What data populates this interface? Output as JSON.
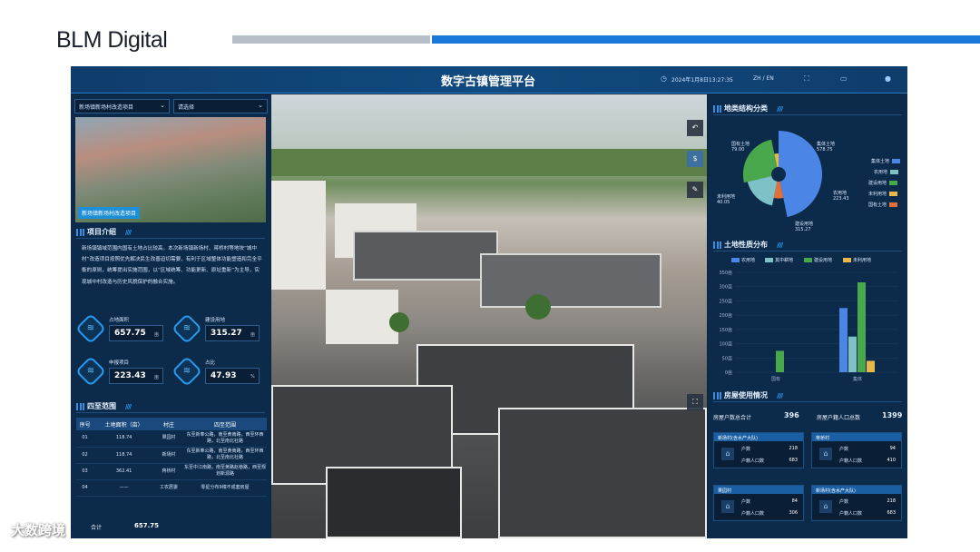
{
  "brand": {
    "name": "BLM Digital"
  },
  "header": {
    "title": "数字古镇管理平台",
    "datetime": "2024年1月8日13:27:35",
    "lang": "ZH / EN"
  },
  "left": {
    "project_select": "新场镇新场村改造项目",
    "filter_select": "请选择",
    "photo_caption": "新场镇新场村改造项目",
    "intro_title": "项目介绍",
    "intro_text": "新场镇镇域范围内国有土地占比较高。本次新场镇新场村、蒋桥村等地块“城中村”改造项目按照优先解决民生改善迫切需要，有利于区域整体功能塑造和完全平衡的原则，统筹提出实施范围，以“区域统筹、功能更新、原址重新”为主导，实现城中村改造与历史风貌保护的融合实施。",
    "stats": [
      {
        "label": "占地面积",
        "value": "657.75",
        "unit": "亩"
      },
      {
        "label": "建设用地",
        "value": "315.27",
        "unit": "亩"
      },
      {
        "label": "申报项目",
        "value": "223.43",
        "unit": "亩"
      },
      {
        "label": "占比",
        "value": "47.93",
        "unit": "%"
      }
    ],
    "boundary_title": "四至范围",
    "boundary_headers": [
      "序号",
      "土地面积（亩）",
      "村庄",
      "四至范围"
    ],
    "boundary_rows": [
      {
        "no": "01",
        "area": "118.74",
        "village": "果园村",
        "range": "东至新奉公路，南至黄南路，西至环西路，北至南北社路"
      },
      {
        "no": "02",
        "area": "118.74",
        "village": "新场村",
        "range": "东至新奉公路，南至黄南路，西至环西路，北至南北社路"
      },
      {
        "no": "03",
        "area": "362.41",
        "village": "蒋桥村",
        "range": "东至中江南路，南至黄路赵巷路，西至规划新源路"
      },
      {
        "no": "04",
        "area": "——",
        "village": "工农居委",
        "range": "零星分布9幢不成套房屋"
      }
    ],
    "total_label": "合计",
    "total_value": "657.75"
  },
  "right": {
    "land_class_title": "地类结构分类",
    "land_nature_title": "土地性质分布",
    "housing_title": "房屋使用情况",
    "pie_labels": [
      {
        "name": "集体土地",
        "value": "578.75"
      },
      {
        "name": "国有土地",
        "value": "79.00"
      },
      {
        "name": "未利用地",
        "value": "40.05"
      },
      {
        "name": "农用地",
        "value": "223.43"
      },
      {
        "name": "建设用地",
        "value": "315.27"
      }
    ],
    "pie_legend": [
      "集体土地",
      "农用地",
      "建设用地",
      "未利用地",
      "国有土地"
    ],
    "bar_legend": [
      "农用地",
      "其中耕地",
      "建设用地",
      "未利用地"
    ],
    "housing": {
      "households_label": "房屋户数总合计",
      "households_value": "396",
      "population_label": "房屋户籍人口总数",
      "population_value": "1399",
      "cards": [
        {
          "title": "新场村(含水产大队)",
          "households": "218",
          "population": "683"
        },
        {
          "title": "蒋桥村",
          "households": "94",
          "population": "410"
        },
        {
          "title": "果园村",
          "households": "84",
          "population": "306"
        },
        {
          "title": "新场村(含水产大队)",
          "households": "218",
          "population": "683"
        }
      ],
      "households_row": "户数",
      "population_row": "户籍人口数"
    }
  },
  "chart_data": [
    {
      "type": "pie",
      "title": "地类结构分类",
      "categories": [
        "集体土地",
        "国有土地",
        "农用地",
        "建设用地",
        "未利用地"
      ],
      "values": [
        578.75,
        79.0,
        223.43,
        315.27,
        40.05
      ],
      "legend_position": "right",
      "colors": [
        "#4b86e6",
        "#e0703a",
        "#7ec2c8",
        "#49a84c",
        "#e8b94a"
      ]
    },
    {
      "type": "bar",
      "title": "土地性质分布",
      "categories": [
        "国有",
        "集体"
      ],
      "series": [
        {
          "name": "农用地",
          "values": [
            0,
            225
          ],
          "color": "#4b86e6"
        },
        {
          "name": "其中耕地",
          "values": [
            0,
            125
          ],
          "color": "#7ec2c8"
        },
        {
          "name": "建设用地",
          "values": [
            75,
            315
          ],
          "color": "#49a84c"
        },
        {
          "name": "未利用地",
          "values": [
            0,
            40
          ],
          "color": "#e8b94a"
        }
      ],
      "ylim": [
        0,
        350
      ],
      "yticks": [
        "0亩",
        "50亩",
        "100亩",
        "150亩",
        "200亩",
        "250亩",
        "300亩",
        "350亩"
      ],
      "legend_position": "top"
    }
  ],
  "watermark": "大数跨境"
}
